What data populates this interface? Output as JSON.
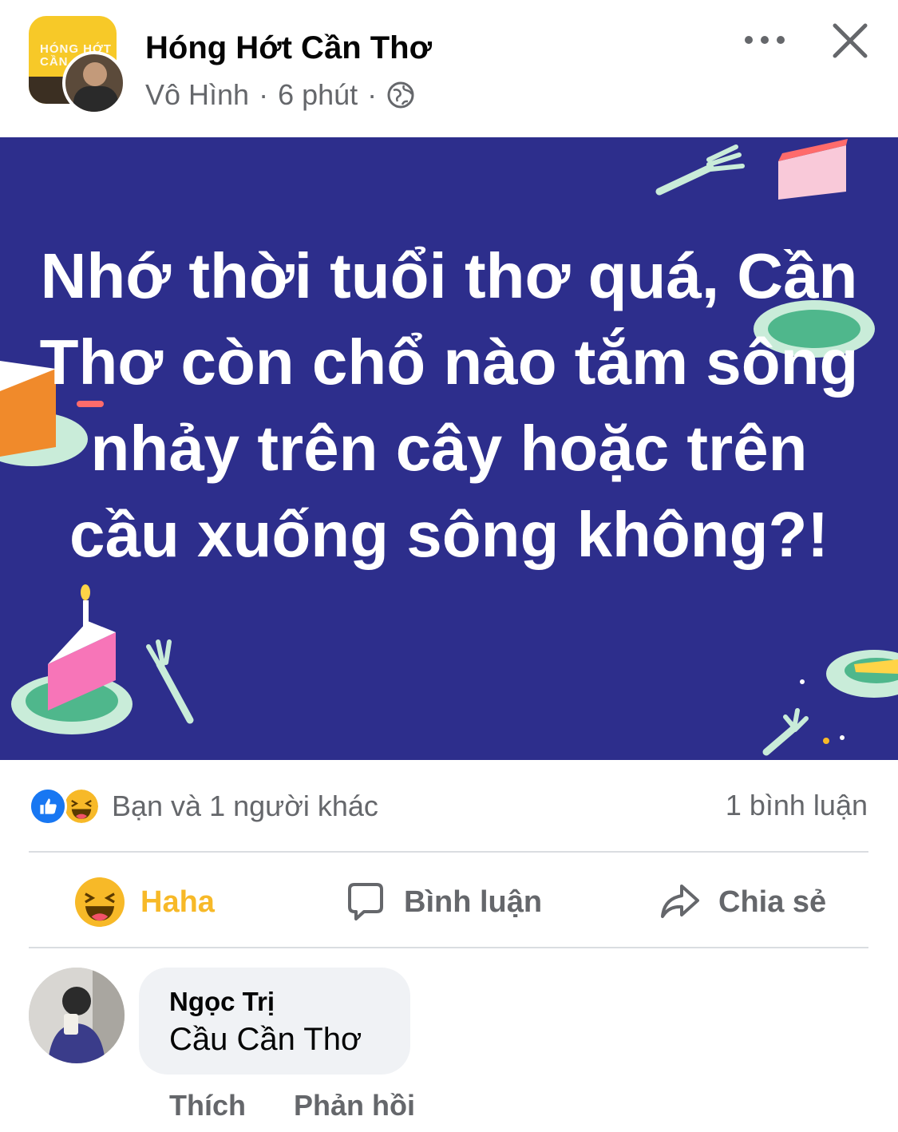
{
  "post": {
    "group_name": "Hóng Hớt Cần Thơ",
    "author": "Vô Hình",
    "time": "6 phút",
    "separator": "·",
    "privacy_icon": "globe-icon",
    "more_icon": "more-horizontal-icon",
    "close_icon": "close-icon",
    "group_avatar_text": "HÓNG HỚT CẦN",
    "image_text": "Nhớ thời tuổi thơ quá, Cần Thơ còn chổ nào tắm sông nhảy trên cây hoặc trên cầu xuống sông không?!",
    "image_bg": "#2d2e8c"
  },
  "reactions": {
    "summary": "Bạn và 1 người khác",
    "comment_count": "1 bình luận",
    "icons": [
      "like-icon",
      "haha-icon"
    ],
    "like_color": "#1877f2",
    "haha_color": "#f7b928"
  },
  "actions": {
    "haha_label": "Haha",
    "comment_label": "Bình luận",
    "share_label": "Chia sẻ"
  },
  "comment": {
    "name": "Ngọc Trị",
    "text": "Cầu Cần Thơ",
    "like_label": "Thích",
    "reply_label": "Phản hồi"
  }
}
